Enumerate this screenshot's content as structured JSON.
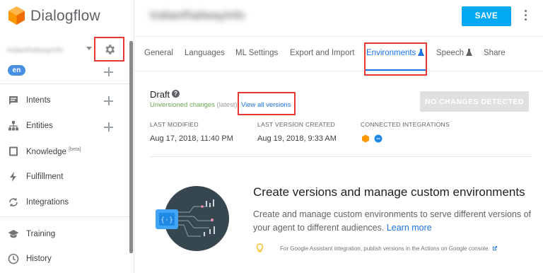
{
  "app": {
    "logo_text": "Dialogflow"
  },
  "sidebar": {
    "agent_name": "IndianRailwayInfo",
    "language": "en",
    "items": [
      {
        "label": "Intents",
        "icon": "chat-bubble-icon"
      },
      {
        "label": "Entities",
        "icon": "sitemap-icon"
      },
      {
        "label": "Knowledge",
        "beta": "[beta]",
        "icon": "book-icon"
      },
      {
        "label": "Fulfillment",
        "icon": "bolt-icon"
      },
      {
        "label": "Integrations",
        "icon": "sync-icon"
      },
      {
        "label": "Training",
        "icon": "graduation-cap-icon"
      },
      {
        "label": "History",
        "icon": "clock-icon"
      }
    ]
  },
  "header": {
    "title": "IndianRailwayInfo",
    "save_label": "SAVE"
  },
  "tabs": [
    {
      "label": "General"
    },
    {
      "label": "Languages"
    },
    {
      "label": "ML Settings"
    },
    {
      "label": "Export and Import"
    },
    {
      "label": "Environments",
      "active": true
    },
    {
      "label": "Speech"
    },
    {
      "label": "Share"
    }
  ],
  "draft": {
    "title": "Draft",
    "unversioned": "Unversioned changes",
    "latest": "(latest)",
    "view_all": "View all versions",
    "no_changes": "NO CHANGES DETECTED"
  },
  "meta": {
    "last_modified_label": "LAST MODIFIED",
    "last_modified_value": "Aug 17, 2018, 11:40 PM",
    "last_version_label": "LAST VERSION CREATED",
    "last_version_value": "Aug 19, 2018, 9:33 AM",
    "integrations_label": "CONNECTED INTEGRATIONS"
  },
  "promo": {
    "title": "Create versions and manage custom environments",
    "body": "Create and manage custom environments to serve different versions of your agent to different audiences.",
    "link": "Learn more",
    "note": "For Google Assistant integration, publish versions in the Actions on Google console."
  },
  "colors": {
    "accent": "#03a9f4",
    "link": "#1a73e8",
    "highlight": "#e53935",
    "success": "#6aa84f"
  }
}
